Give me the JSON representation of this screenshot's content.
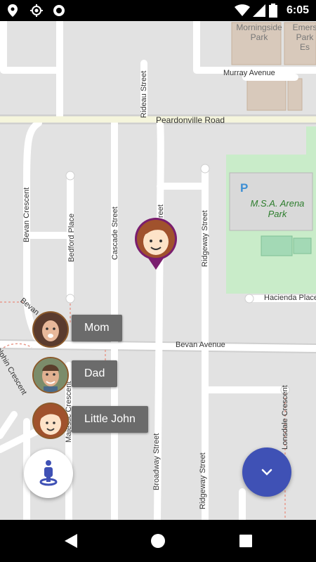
{
  "status_bar": {
    "time": "6:05",
    "icons": [
      "location-pin-icon",
      "gps-icon",
      "circle-icon",
      "wifi-icon",
      "signal-icon",
      "battery-icon"
    ]
  },
  "map": {
    "roads": {
      "peardonville": "Peardonville Road",
      "murray": "Murray Avenue",
      "rideau": "Rideau Street",
      "bevan_crescent": "Bevan Crescent",
      "bedford": "Bedford Place",
      "cascade": "Cascade Street",
      "ridgeway": "Ridgeway Street",
      "broadway": "Broadway Street",
      "broadway_partial": "reet",
      "hacienda": "Hacienda Place",
      "bevan_avenue": "Bevan Avenue",
      "bevan_partial": "Bevan",
      "dolphin": "olphin Crescent",
      "majestic": "Majestic Crescent",
      "lonsdale": "Lonsdale Crescent",
      "ridgeway_lower": "Ridgeway Street",
      "broadway_lower": "Broadway Street"
    },
    "places": {
      "morningside": "Morningside Park",
      "emerson": "Emers Park Es",
      "arena": "M.S.A. Arena Park",
      "parking_symbol": "P"
    }
  },
  "people": [
    {
      "name": "Mom"
    },
    {
      "name": "Dad"
    },
    {
      "name": "Little John"
    }
  ],
  "colors": {
    "fab_accent": "#3f51b5",
    "pin": "#7a1e6e",
    "chip_bg": "#6b6b6b"
  },
  "nav_bar": {
    "buttons": [
      "back-icon",
      "home-icon",
      "recents-icon"
    ]
  }
}
